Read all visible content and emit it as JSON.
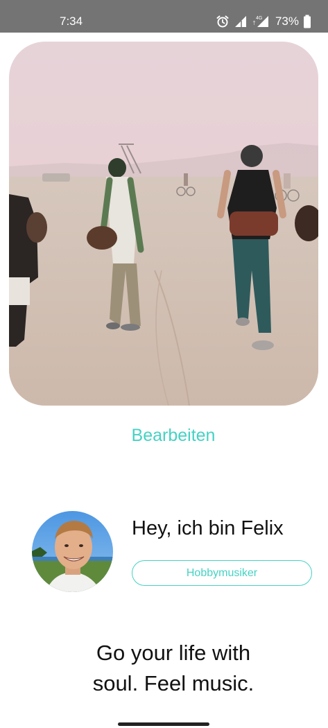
{
  "status_bar": {
    "time": "7:34",
    "network": "4G",
    "battery": "73%",
    "icons": [
      "alarm-icon",
      "signal-icon",
      "signal-4g-icon",
      "battery-icon"
    ]
  },
  "hero": {
    "image": "desert-festival-drummers-photo"
  },
  "edit_link": "Bearbeiten",
  "profile": {
    "avatar": "profile-photo",
    "greeting": "Hey, ich bin Felix",
    "tag": "Hobbymusiker"
  },
  "tagline": {
    "line1": "Go your life with",
    "line2": "soul. Feel music."
  },
  "colors": {
    "accent": "#45d2c3",
    "status_bar": "#747474",
    "text": "#111111"
  }
}
